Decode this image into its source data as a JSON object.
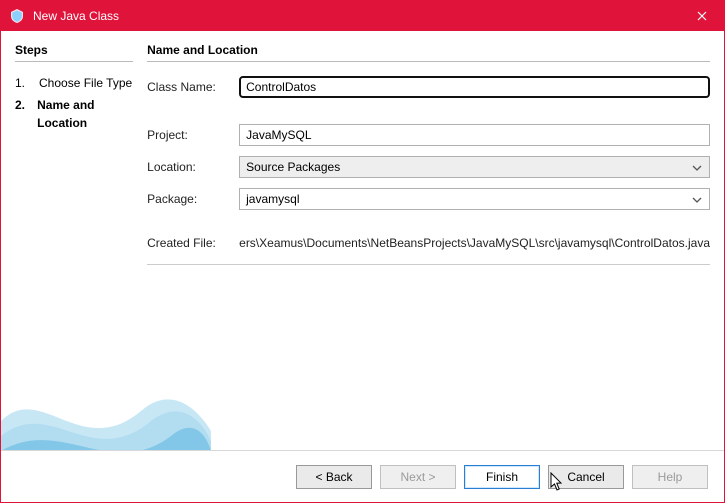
{
  "window": {
    "title": "New Java Class"
  },
  "steps": {
    "heading": "Steps",
    "items": [
      {
        "num": "1.",
        "label": "Choose File Type",
        "current": false
      },
      {
        "num": "2.",
        "label": "Name and Location",
        "current": true
      }
    ]
  },
  "panel": {
    "heading": "Name and Location",
    "className": {
      "label": "Class Name:",
      "value": "ControlDatos"
    },
    "project": {
      "label": "Project:",
      "value": "JavaMySQL"
    },
    "location": {
      "label": "Location:",
      "value": "Source Packages"
    },
    "package": {
      "label": "Package:",
      "value": "javamysql"
    },
    "createdFile": {
      "label": "Created File:",
      "value": "ers\\Xeamus\\Documents\\NetBeansProjects\\JavaMySQL\\src\\javamysql\\ControlDatos.java"
    }
  },
  "buttons": {
    "back": "< Back",
    "next": "Next >",
    "finish": "Finish",
    "cancel": "Cancel",
    "help": "Help"
  }
}
